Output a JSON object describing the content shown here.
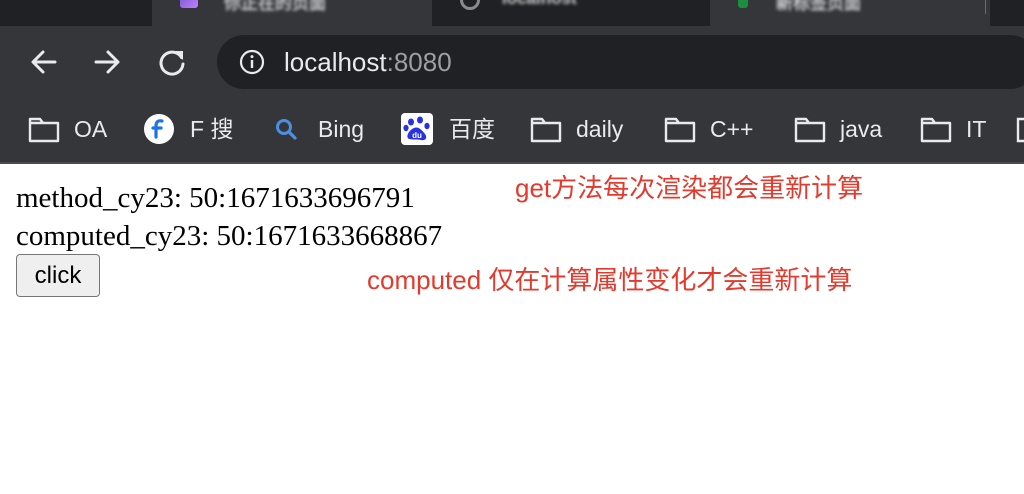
{
  "browser": {
    "tabs": [
      {
        "title": "你正在的页面"
      },
      {
        "title": "localhost"
      },
      {
        "title": "新标签页面"
      }
    ],
    "address": {
      "host": "localhost",
      "port": ":8080"
    },
    "bookmarks": [
      {
        "label": "OA",
        "icon": "folder-icon"
      },
      {
        "label": "F 搜",
        "icon": "fsou-logo-icon"
      },
      {
        "label": "Bing",
        "icon": "search-icon"
      },
      {
        "label": "百度",
        "icon": "baidu-paw-icon"
      },
      {
        "label": "daily",
        "icon": "folder-icon"
      },
      {
        "label": "C++",
        "icon": "folder-icon"
      },
      {
        "label": "java",
        "icon": "folder-icon"
      },
      {
        "label": "IT",
        "icon": "folder-icon"
      }
    ]
  },
  "page": {
    "method_line": "method_cy23: 50:1671633696791",
    "computed_line": "computed_cy23: 50:1671633668867",
    "button_label": "click"
  },
  "annotations": {
    "get_note": "get方法每次渲染都会重新计算",
    "computed_note": "computed 仅在计算属性变化才会重新计算",
    "color": "#e23b2e"
  },
  "colors": {
    "chrome_bg": "#35363a",
    "tabstrip_bg": "#202124",
    "omnibox_bg": "#202124"
  }
}
